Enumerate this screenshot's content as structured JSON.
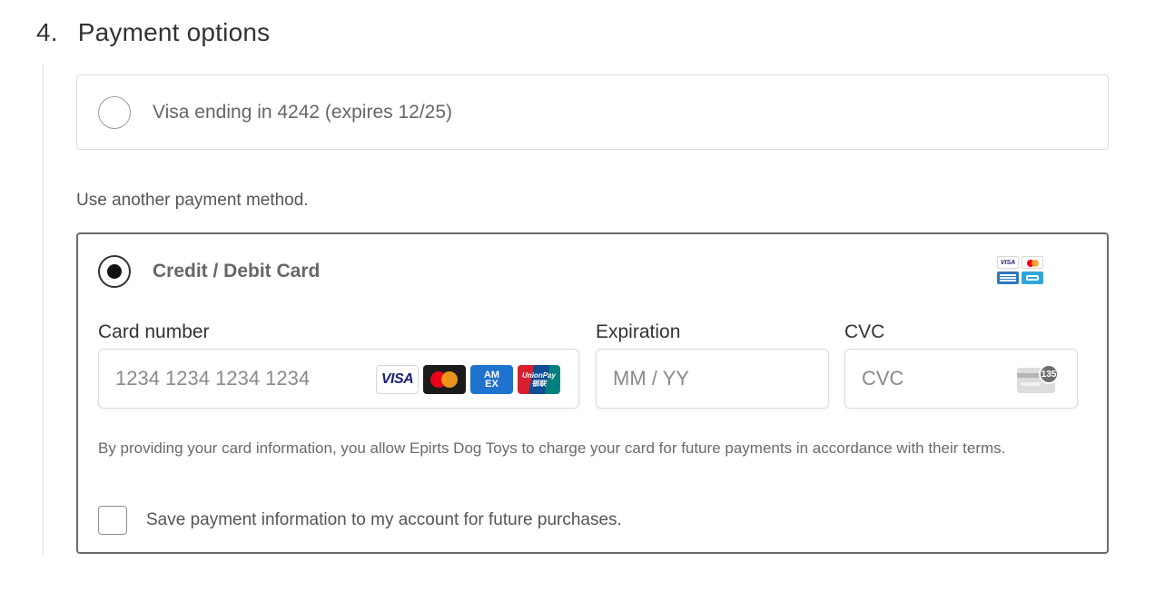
{
  "step": {
    "number": "4.",
    "title": "Payment options"
  },
  "saved_card": {
    "label": "Visa ending in 4242 (expires 12/25)",
    "selected": false
  },
  "alt_heading": "Use another payment method.",
  "card_method": {
    "title": "Credit / Debit Card",
    "selected": true,
    "accepted_brands": [
      "visa",
      "mastercard",
      "amex",
      "jcb"
    ]
  },
  "fields": {
    "card_number": {
      "label": "Card number",
      "placeholder": "1234 1234 1234 1234",
      "value": "",
      "brands": [
        "visa",
        "mastercard",
        "amex",
        "unionpay"
      ]
    },
    "expiration": {
      "label": "Expiration",
      "placeholder": "MM / YY",
      "value": ""
    },
    "cvc": {
      "label": "CVC",
      "placeholder": "CVC",
      "value": "",
      "icon_badge": "135"
    }
  },
  "brand_logos": {
    "visa": "VISA",
    "amex_line1": "AM",
    "amex_line2": "EX",
    "unionpay_line1": "UnionPay",
    "unionpay_line2": "银联"
  },
  "consent_text": "By providing your card information, you allow Epirts Dog Toys to charge your card for future payments in accordance with their terms.",
  "save_option": {
    "label": "Save payment information to my account for future purchases.",
    "checked": false
  },
  "colors": {
    "panel_border": "#6b6b6b",
    "light_border": "#dedede",
    "text_muted": "#666666",
    "radio_fill": "#111111"
  },
  "icons": {
    "saved_card_radio": "radio-unselected-icon",
    "card_method_radio": "radio-selected-icon",
    "cvc": "card-back-cvc-icon"
  }
}
